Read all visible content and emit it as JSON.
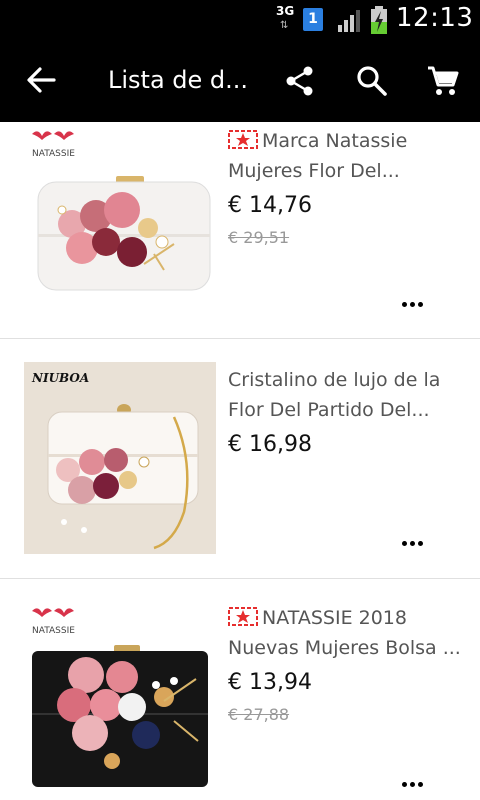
{
  "status_bar": {
    "network": "3G",
    "sim": "1",
    "time": "12:13"
  },
  "app_bar": {
    "title": "Lista de d...",
    "back_icon": "arrow-back-icon",
    "share_icon": "share-icon",
    "search_icon": "search-icon",
    "cart_icon": "shopping-cart-icon"
  },
  "products": [
    {
      "brand_logo": "NATASSIE",
      "name": "Marca Natassie Mujeres Flor Del...",
      "price": "€ 14,76",
      "original_price": "€ 29,51",
      "badge_icon": "flash-deal-icon"
    },
    {
      "brand_logo": "NIUBOA",
      "name": "Cristalino de lujo de la Flor Del Partido Del...",
      "price": "€ 16,98"
    },
    {
      "brand_logo": "NATASSIE",
      "name": "NATASSIE 2018 Nuevas Mujeres Bolsa ...",
      "price": "€ 13,94",
      "original_price": "€ 27,88",
      "badge_icon": "flash-deal-icon"
    }
  ],
  "colors": {
    "bar_bg": "#000000",
    "badge_red": "#e62e2e",
    "sim_blue": "#2b7fe0",
    "battery_green": "#66cc33"
  }
}
